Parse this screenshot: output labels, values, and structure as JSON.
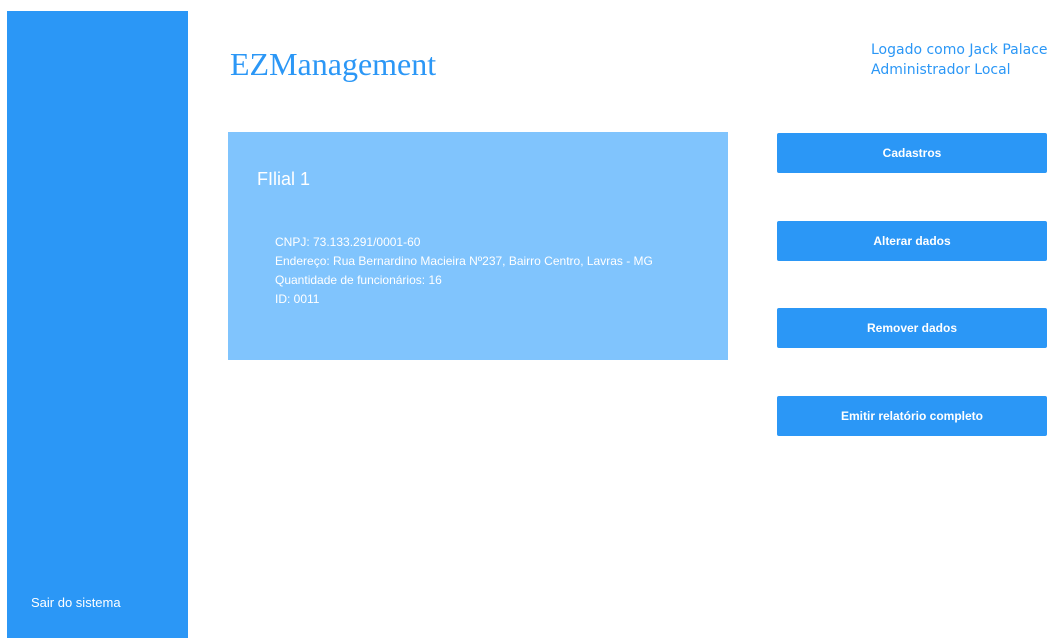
{
  "colors": {
    "primary": "#2b97f6",
    "card_background": "#80c4fd",
    "text_on_primary": "#ffffff"
  },
  "app": {
    "brand": "EZManagement"
  },
  "user": {
    "logged_as": "Logado como Jack Palace",
    "role": "Administrador Local"
  },
  "sidebar": {
    "logout_label": "Sair do sistema"
  },
  "branch": {
    "title": "FIlial 1",
    "cnpj": "CNPJ: 73.133.291/0001-60",
    "address": "Endereço: Rua Bernardino Macieira Nº237, Bairro Centro, Lavras - MG",
    "employees": "Quantidade de funcionários: 16",
    "id": "ID: 0011"
  },
  "actions": {
    "register": "Cadastros",
    "edit": "Alterar dados",
    "remove": "Remover dados",
    "report": "Emitir relatório completo"
  }
}
